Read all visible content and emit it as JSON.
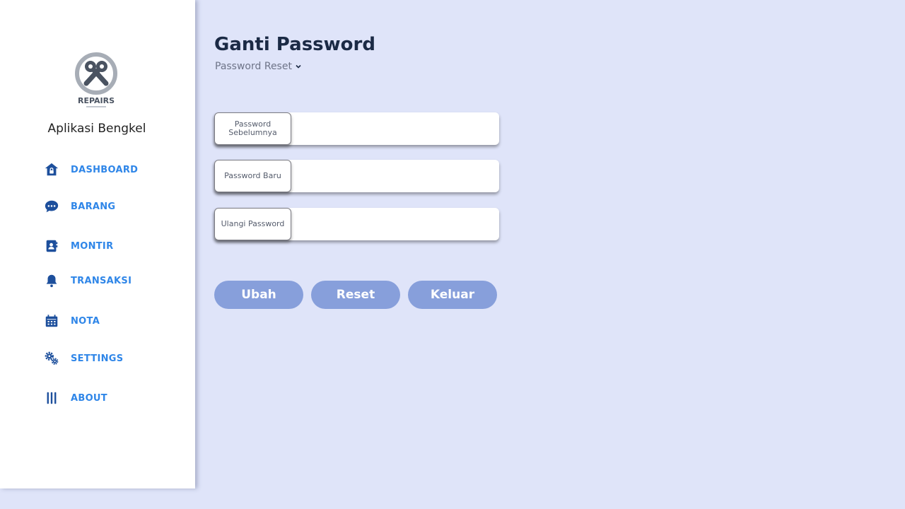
{
  "sidebar": {
    "logo_text": "REPAIRS",
    "app_title": "Aplikasi Bengkel",
    "items": [
      {
        "label": "DASHBOARD",
        "icon": "home-lock-icon"
      },
      {
        "label": "BARANG",
        "icon": "chat-bubble-icon"
      },
      {
        "label": "MONTIR",
        "icon": "contact-book-icon"
      },
      {
        "label": "TRANSAKSI",
        "icon": "bell-icon"
      },
      {
        "label": "NOTA",
        "icon": "calendar-icon"
      },
      {
        "label": "SETTINGS",
        "icon": "cogs-icon"
      },
      {
        "label": "ABOUT",
        "icon": "bars-icon"
      }
    ]
  },
  "main": {
    "title": "Ganti Password",
    "breadcrumb": "Password Reset",
    "fields": [
      {
        "label": "Password Sebelumnya",
        "value": ""
      },
      {
        "label": "Password Baru",
        "value": ""
      },
      {
        "label": "Ulangi Password",
        "value": ""
      }
    ],
    "buttons": {
      "submit": "Ubah",
      "reset": "Reset",
      "logout": "Keluar"
    }
  },
  "colors": {
    "background": "#dfe4f9",
    "nav_label": "#2f86e8",
    "nav_icon": "#1d4f9c",
    "button": "#879fdb",
    "title": "#1b2a45"
  }
}
